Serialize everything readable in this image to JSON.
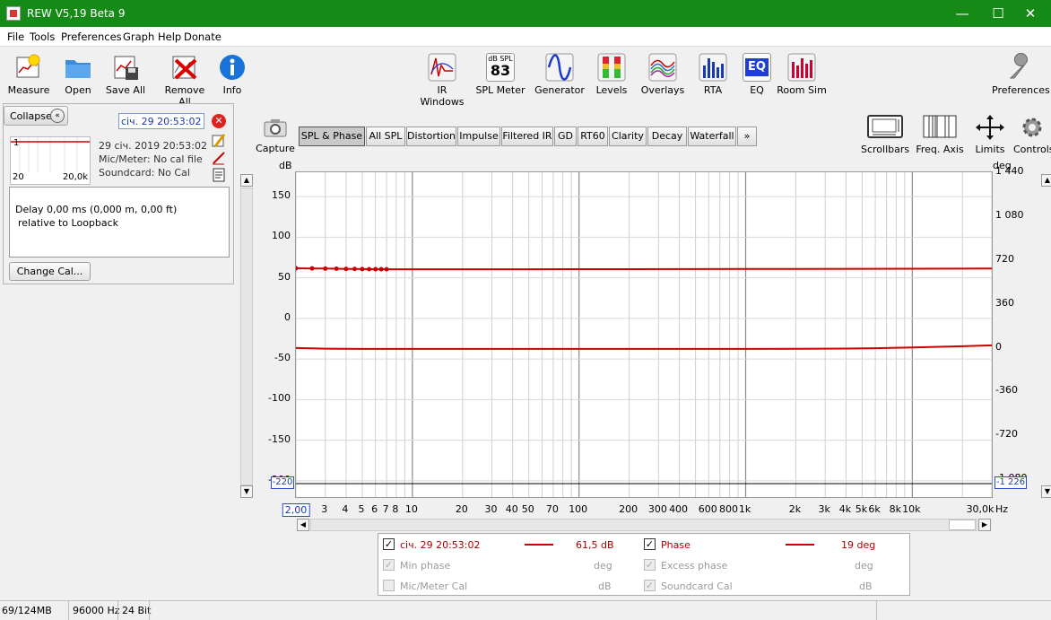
{
  "window": {
    "title": "REW V5,19 Beta 9"
  },
  "menu": [
    "File",
    "Tools",
    "Preferences",
    "Graph",
    "Help",
    "Donate"
  ],
  "toolbar_left": [
    {
      "label": "Measure",
      "icon": "measure-icon"
    },
    {
      "label": "Open",
      "icon": "folder-icon"
    },
    {
      "label": "Save All",
      "icon": "save-all-icon"
    },
    {
      "label": "Remove All",
      "icon": "remove-all-icon"
    },
    {
      "label": "Info",
      "icon": "info-icon"
    }
  ],
  "toolbar_center": [
    {
      "label": "IR Windows",
      "icon": "ir-windows-icon"
    },
    {
      "label": "SPL Meter",
      "icon": "spl-meter-icon",
      "badge_top": "dB SPL",
      "badge_value": "83"
    },
    {
      "label": "Generator",
      "icon": "generator-icon"
    },
    {
      "label": "Levels",
      "icon": "levels-icon"
    },
    {
      "label": "Overlays",
      "icon": "overlays-icon"
    },
    {
      "label": "RTA",
      "icon": "rta-icon"
    },
    {
      "label": "EQ",
      "icon": "eq-icon",
      "badge": "EQ"
    },
    {
      "label": "Room Sim",
      "icon": "room-sim-icon"
    }
  ],
  "toolbar_right": {
    "label": "Preferences",
    "icon": "wrench-icon"
  },
  "measurement_panel": {
    "collapse_label": "Collapse",
    "name": "січ. 29 20:53:02",
    "date": "29 січ. 2019 20:53:02",
    "mic": "Mic/Meter: No cal file",
    "soundcard": "Soundcard: No Cal",
    "thumb_left": "20",
    "thumb_right": "20,0k",
    "thumb_number": "1",
    "delay": "Delay 0,00 ms (0,000 m, 0,00 ft)",
    "relative": "relative to Loopback",
    "change_cal": "Change Cal..."
  },
  "capture": {
    "label": "Capture"
  },
  "tabs": [
    "SPL & Phase",
    "All SPL",
    "Distortion",
    "Impulse",
    "Filtered IR",
    "GD",
    "RT60",
    "Clarity",
    "Decay",
    "Waterfall",
    "»"
  ],
  "active_tab": 0,
  "graph_controls": [
    {
      "label": "Scrollbars",
      "icon": "scrollbars-icon"
    },
    {
      "label": "Freq. Axis",
      "icon": "freq-axis-icon"
    },
    {
      "label": "Limits",
      "icon": "limits-icon"
    },
    {
      "label": "Controls",
      "icon": "gear-icon"
    }
  ],
  "chart_data": {
    "type": "line",
    "xlabel": "Hz",
    "ylabel": "dB",
    "y2label": "deg",
    "x_log": true,
    "xlim": [
      2.0,
      30000
    ],
    "ylim": [
      -220,
      180
    ],
    "y2lim": [
      -1226,
      1440
    ],
    "x_ticks": [
      "2,00",
      "3",
      "4",
      "5",
      "6",
      "7",
      "8",
      "10",
      "20",
      "30",
      "40",
      "50",
      "70",
      "100",
      "200",
      "300",
      "400",
      "600",
      "800",
      "1k",
      "2k",
      "3k",
      "4k",
      "5k",
      "6k",
      "8k",
      "10k",
      "30,0k"
    ],
    "x_tick_values": [
      2,
      3,
      4,
      5,
      6,
      7,
      8,
      10,
      20,
      30,
      40,
      50,
      70,
      100,
      200,
      300,
      400,
      600,
      800,
      1000,
      2000,
      3000,
      4000,
      5000,
      6000,
      8000,
      10000,
      30000
    ],
    "y_ticks": [
      "150",
      "100",
      "50",
      "0",
      "-50",
      "-100",
      "-150",
      "-200"
    ],
    "y_tick_values": [
      150,
      100,
      50,
      0,
      -50,
      -100,
      -150,
      -200
    ],
    "y_min_label": "-220",
    "y2_ticks": [
      "1 440",
      "1 080",
      "720",
      "360",
      "0",
      "-360",
      "-720",
      "-1 080"
    ],
    "y2_tick_values": [
      1440,
      1080,
      720,
      360,
      0,
      -360,
      -720,
      -1080
    ],
    "y2_min_label": "-1 226",
    "grid": true,
    "series": [
      {
        "name": "січ. 29 20:53:02",
        "color": "#cc0000",
        "axis": "left",
        "x": [
          2,
          2.5,
          3,
          3.5,
          4,
          4.5,
          5,
          5.5,
          6,
          6.5,
          7,
          8,
          10,
          20,
          50,
          100,
          200,
          500,
          1000,
          2000,
          5000,
          10000,
          20000,
          30000
        ],
        "y": [
          61.8,
          61.6,
          61.4,
          61.2,
          61.0,
          60.9,
          60.8,
          60.7,
          60.6,
          60.6,
          60.5,
          60.5,
          60.5,
          60.6,
          60.6,
          60.7,
          60.7,
          60.8,
          60.9,
          61.0,
          61.1,
          61.2,
          61.3,
          61.5
        ],
        "markers_until": 7
      },
      {
        "name": "Phase",
        "color": "#cc0000",
        "axis": "right",
        "x": [
          2,
          2.5,
          3,
          4,
          5,
          7,
          10,
          20,
          50,
          100,
          200,
          500,
          1000,
          2000,
          4000,
          6000,
          10000,
          20000,
          30000
        ],
        "y": [
          -3,
          -6,
          -8,
          -9,
          -10,
          -10,
          -10,
          -10,
          -10,
          -10,
          -10,
          -10,
          -10,
          -9,
          -7,
          -4,
          2,
          12,
          19
        ]
      }
    ]
  },
  "legend": {
    "rows": [
      {
        "col1": {
          "checked": true,
          "enabled": true,
          "label": "січ. 29 20:53:02",
          "value": "61,5 dB",
          "line_color": "#cc0000"
        },
        "col2": {
          "checked": true,
          "enabled": true,
          "label": "Phase",
          "value": "19 deg",
          "line_color": "#cc0000"
        }
      },
      {
        "col1": {
          "checked": true,
          "enabled": false,
          "label": "Min phase",
          "value": "deg"
        },
        "col2": {
          "checked": true,
          "enabled": false,
          "label": "Excess phase",
          "value": "deg"
        }
      },
      {
        "col1": {
          "checked": false,
          "enabled": false,
          "label": "Mic/Meter Cal",
          "value": "dB"
        },
        "col2": {
          "checked": true,
          "enabled": false,
          "label": "Soundcard Cal",
          "value": "dB"
        }
      }
    ]
  },
  "status": {
    "memory": "69/124MB",
    "rate": "96000 Hz",
    "bits": "24 Bit"
  }
}
